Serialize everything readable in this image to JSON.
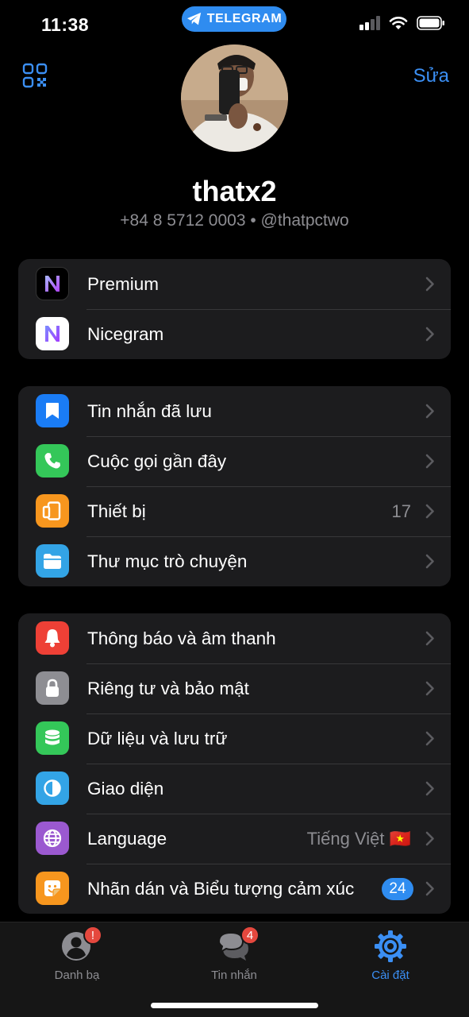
{
  "status_bar": {
    "time": "11:38",
    "app_pill": "TELEGRAM"
  },
  "header": {
    "edit_label": "Sửa",
    "qr_icon": "qr-code-icon"
  },
  "profile": {
    "name": "thatx2",
    "subtitle": "+84 8 5712 0003 • @thatpctwo"
  },
  "groups": [
    {
      "items": [
        {
          "label": "Premium",
          "icon": "nicegram-n-icon",
          "color": "#000000"
        },
        {
          "label": "Nicegram",
          "icon": "nicegram-n-icon",
          "color": "#ffffff"
        }
      ]
    },
    {
      "items": [
        {
          "label": "Tin nhắn đã lưu",
          "icon": "bookmark-icon",
          "color": "#1a7cf5"
        },
        {
          "label": "Cuộc gọi gần đây",
          "icon": "phone-icon",
          "color": "#34c759"
        },
        {
          "label": "Thiết bị",
          "value": "17",
          "icon": "devices-icon",
          "color": "#f7961e"
        },
        {
          "label": "Thư mục trò chuyện",
          "icon": "folder-icon",
          "color": "#33a4e6"
        }
      ]
    },
    {
      "items": [
        {
          "label": "Thông báo và âm thanh",
          "icon": "bell-icon",
          "color": "#ee4036"
        },
        {
          "label": "Riêng tư và bảo mật",
          "icon": "lock-icon",
          "color": "#8e8e93"
        },
        {
          "label": "Dữ liệu và lưu trữ",
          "icon": "database-icon",
          "color": "#34c759"
        },
        {
          "label": "Giao diện",
          "icon": "appearance-icon",
          "color": "#33a4e6"
        },
        {
          "label": "Language",
          "value": "Tiếng Việt 🇻🇳",
          "icon": "globe-icon",
          "color": "#9b59d0"
        },
        {
          "label": "Nhãn dán và Biểu tượng cảm xúc",
          "badge": "24",
          "icon": "sticker-icon",
          "color": "#f7961e"
        }
      ]
    }
  ],
  "tabs": [
    {
      "label": "Danh bạ",
      "badge": "!",
      "icon": "contacts-icon"
    },
    {
      "label": "Tin nhắn",
      "badge": "4",
      "icon": "chats-icon"
    },
    {
      "label": "Cài đặt",
      "icon": "settings-gear-icon",
      "active": true
    }
  ]
}
